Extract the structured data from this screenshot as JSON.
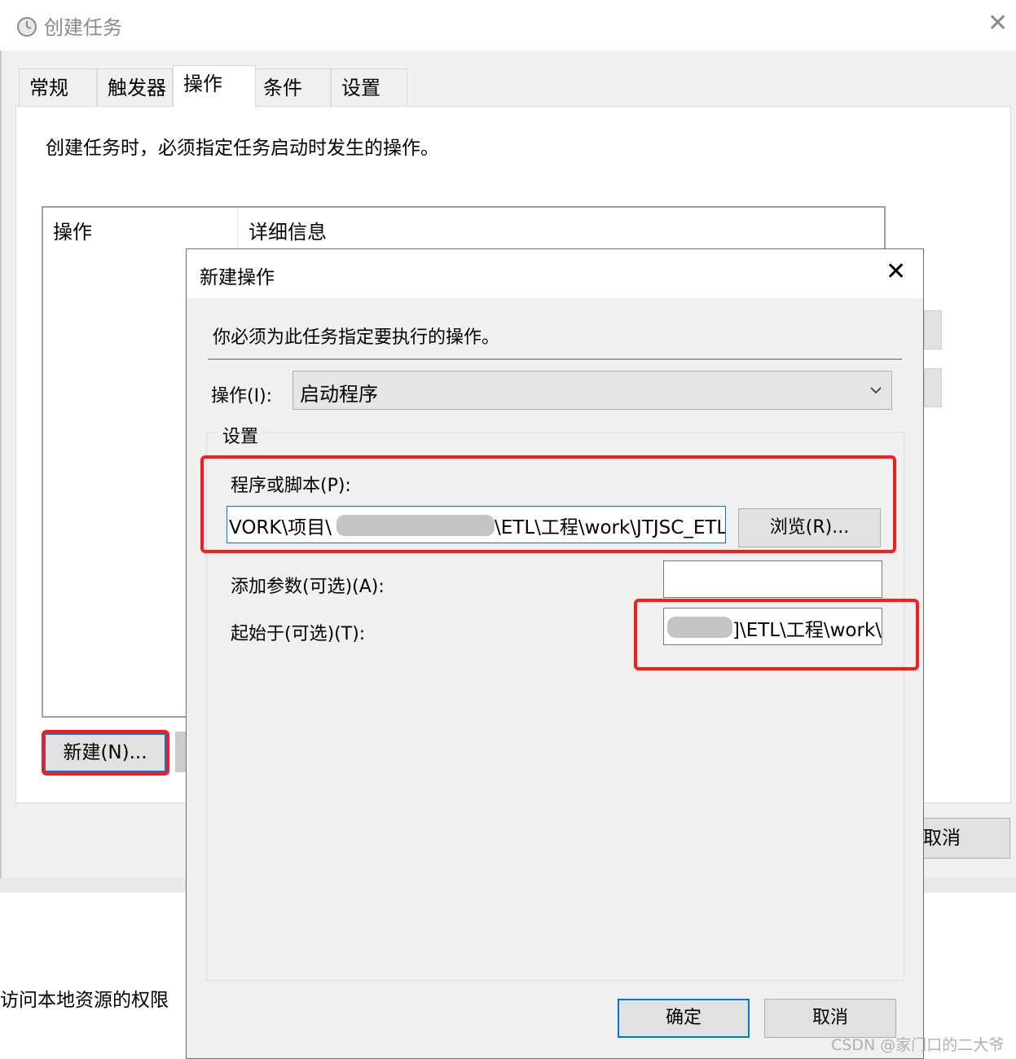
{
  "outer_window": {
    "title": "创建任务",
    "close_glyph": "✕",
    "tabs": [
      {
        "label": "常规",
        "active": false
      },
      {
        "label": "触发器",
        "active": false
      },
      {
        "label": "操作",
        "active": true
      },
      {
        "label": "条件",
        "active": false
      },
      {
        "label": "设置",
        "active": false
      }
    ],
    "description": "创建任务时，必须指定任务启动时发生的操作。",
    "list_columns": [
      "操作",
      "详细信息"
    ],
    "new_button": "新建(N)...",
    "cancel_partial": "取消",
    "bottom_left_text": "访问本地资源的权限"
  },
  "dialog": {
    "title": "新建操作",
    "close_glyph": "✕",
    "description": "你必须为此任务指定要执行的操作。",
    "action_label": "操作(I):",
    "action_value": "启动程序",
    "settings_legend": "设置",
    "program_label": "程序或脚本(P):",
    "program_value_start": "VORK\\项目\\",
    "program_value_end": "\\ETL\\工程\\work\\JTJSC_ETL.bat",
    "browse_button": "浏览(R)...",
    "args_label": "添加参数(可选)(A):",
    "args_value": "",
    "start_label": "起始于(可选)(T):",
    "start_value": "]\\ETL\\工程\\work\\",
    "ok_button": "确定",
    "cancel_button": "取消"
  },
  "watermark": "CSDN @家门口的二大爷",
  "colors": {
    "highlight_red": "#ff1a1a",
    "focus_blue": "#0078d7",
    "dialog_bg": "#f0f0f0"
  }
}
